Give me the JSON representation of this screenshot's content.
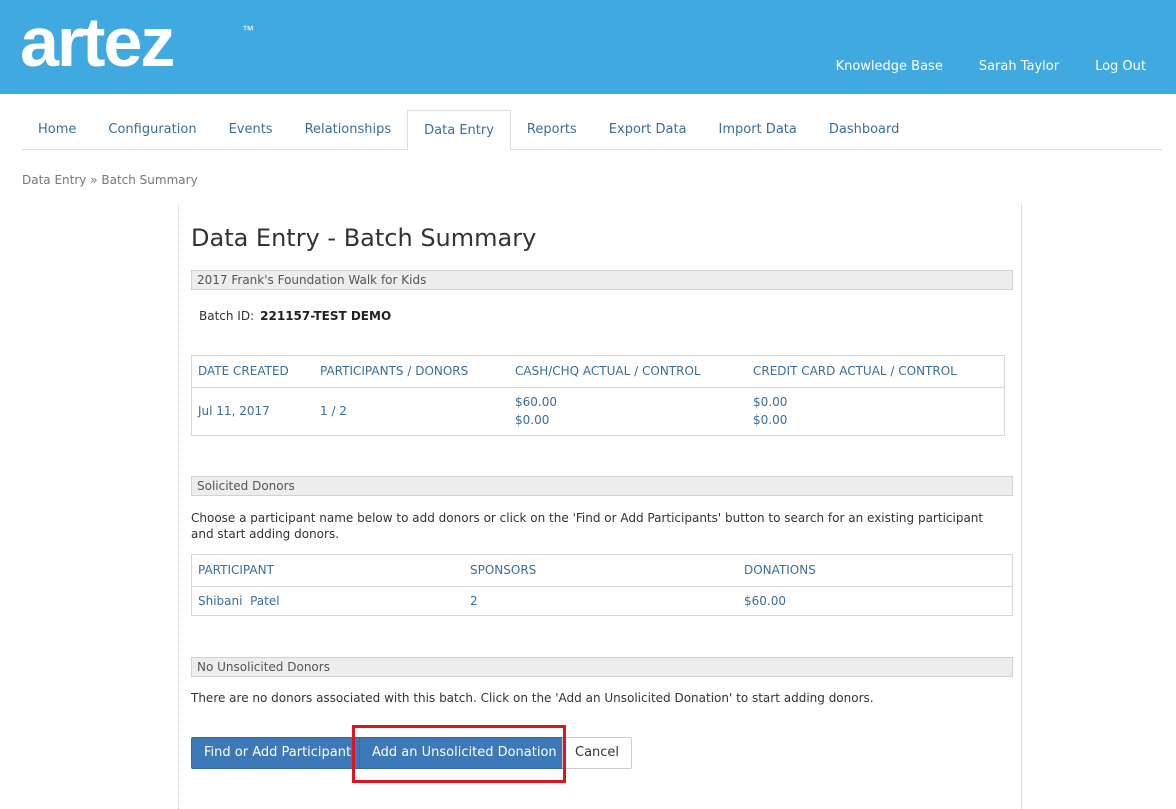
{
  "brand": {
    "logo_text": "artez",
    "tm": "™",
    "header_color": "#3fa9e0"
  },
  "top_links": [
    "Knowledge Base",
    "Sarah Taylor",
    "Log Out"
  ],
  "nav_tabs": [
    "Home",
    "Configuration",
    "Events",
    "Relationships",
    "Data Entry",
    "Reports",
    "Export Data",
    "Import Data",
    "Dashboard"
  ],
  "active_tab": "Data Entry",
  "breadcrumb": "Data Entry » Batch Summary",
  "page_title": "Data Entry - Batch Summary",
  "event_name": "2017 Frank's Foundation Walk for Kids",
  "batch": {
    "label": "Batch ID:",
    "value": "221157-TEST DEMO"
  },
  "summary_table": {
    "headers": [
      "DATE CREATED",
      "PARTICIPANTS / DONORS",
      "CASH/CHQ ACTUAL / CONTROL",
      "CREDIT CARD ACTUAL / CONTROL"
    ],
    "row": {
      "date": "Jul 11, 2017",
      "participants": "1 / 2",
      "cash_actual": "$60.00",
      "cash_control": "$0.00",
      "cc_actual": "$0.00",
      "cc_control": "$0.00"
    }
  },
  "solicited": {
    "title": "Solicited Donors",
    "description": "Choose a participant name below to add donors or click on the 'Find or Add Participants' button to search for an existing participant and start adding donors.",
    "headers": [
      "PARTICIPANT",
      "SPONSORS",
      "DONATIONS"
    ],
    "rows": [
      {
        "participant": "Shibani  Patel",
        "sponsors": "2",
        "donations": "$60.00"
      }
    ]
  },
  "unsolicited": {
    "title": "No Unsolicited Donors",
    "description": "There are no donors associated with this batch. Click on the 'Add an Unsolicited Donation' to start adding donors."
  },
  "buttons": {
    "find_add": "Find or Add Participant",
    "add_unsolicited": "Add an Unsolicited Donation",
    "cancel": "Cancel"
  }
}
